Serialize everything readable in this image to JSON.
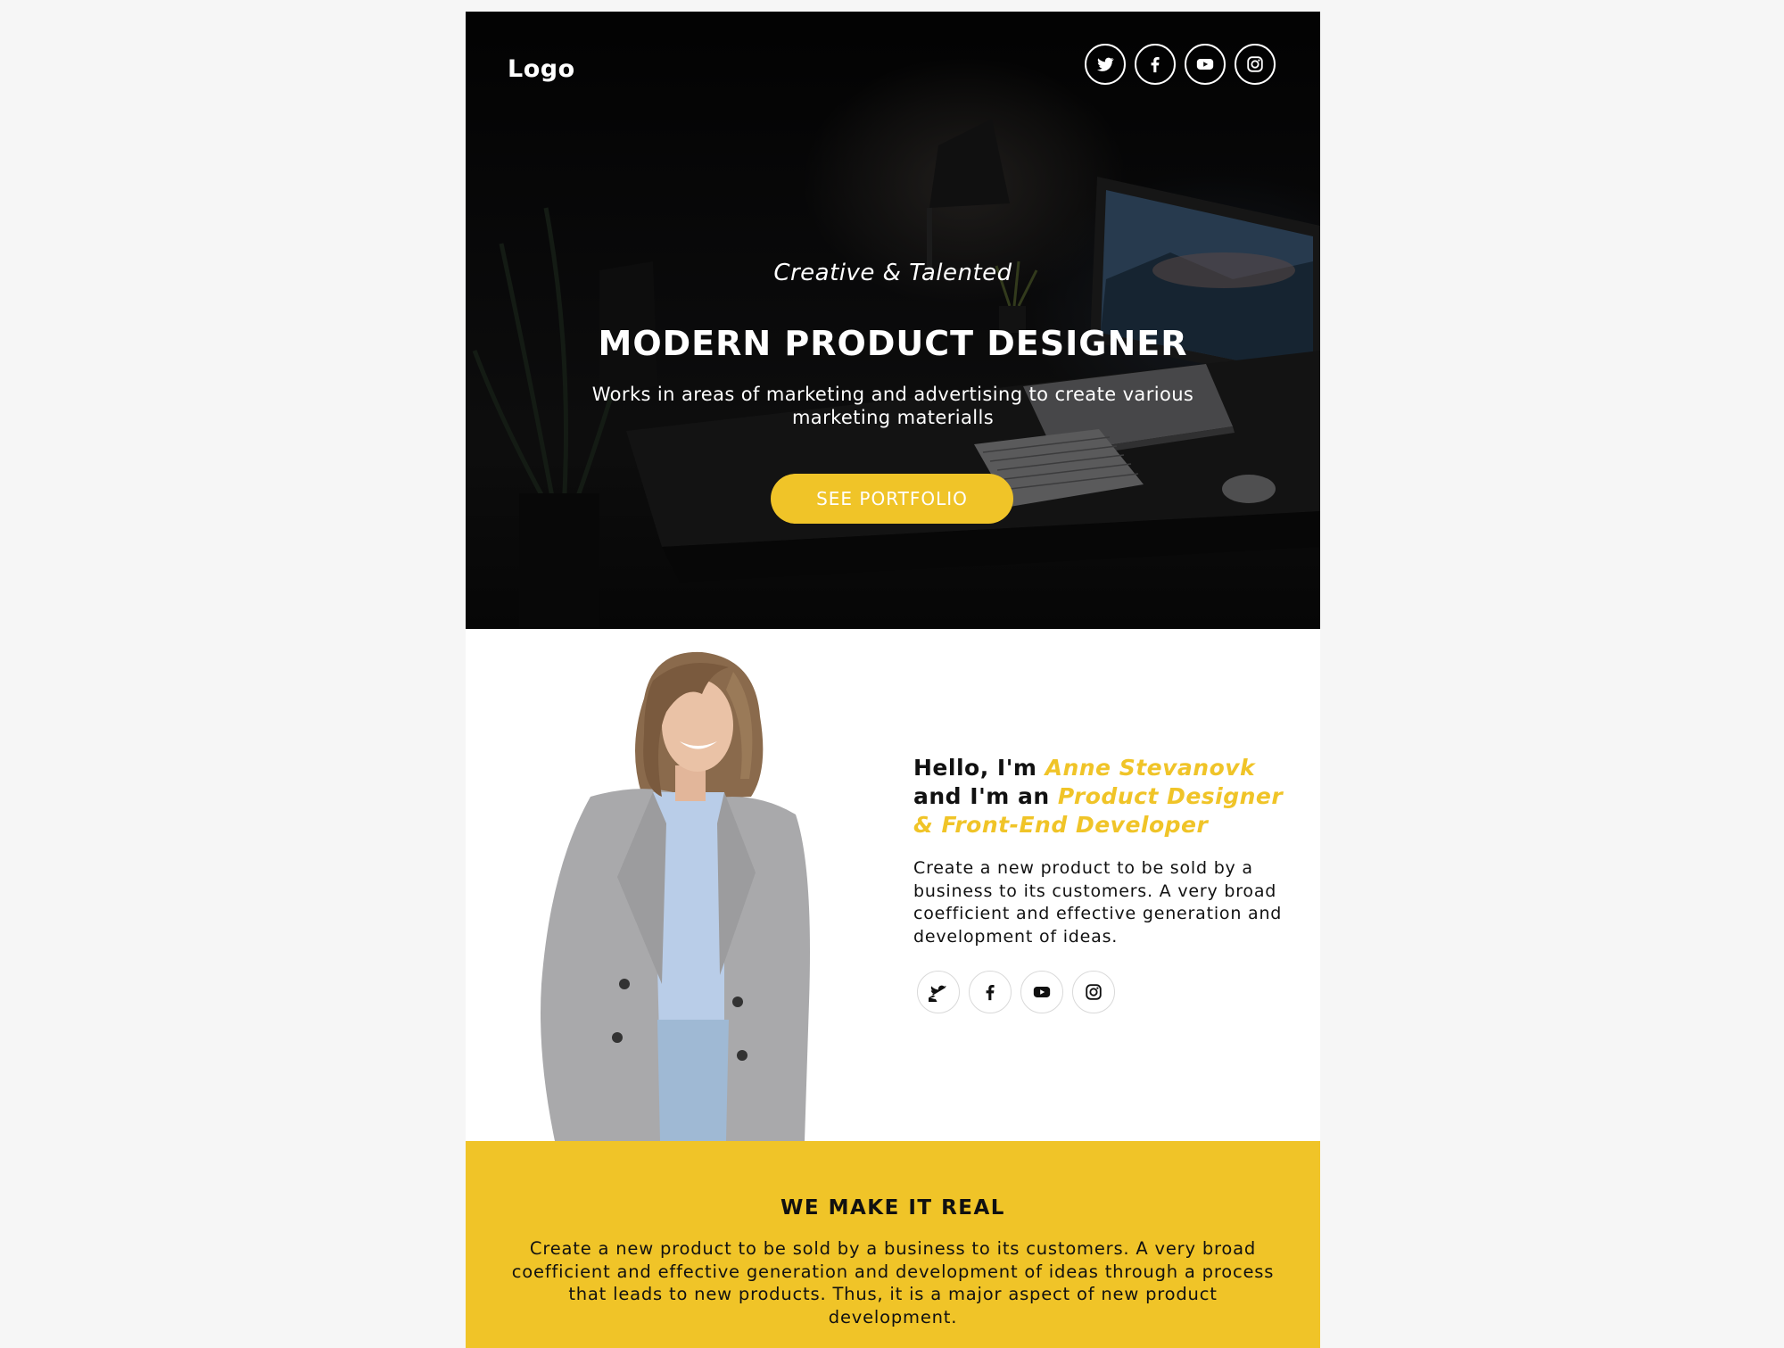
{
  "hero": {
    "logo": "Logo",
    "tagline": "Creative & Talented",
    "headline": "MODERN PRODUCT DESIGNER",
    "subhead": "Works in areas of marketing and advertising to create various marketing materialls",
    "cta_label": "SEE PORTFOLIO",
    "social_icons": [
      "twitter-icon",
      "facebook-icon",
      "youtube-icon",
      "instagram-icon"
    ]
  },
  "about": {
    "greeting_prefix": "Hello, I'm ",
    "name": "Anne Stevanovk",
    "greeting_middle": " and I'm an ",
    "role": "Product Designer & Front-End Developer",
    "body": "Create a new product to be sold by a business to its customers. A very broad coefficient and effective generation and development of ideas.",
    "social_icons": [
      "twitter-icon",
      "facebook-icon",
      "youtube-icon",
      "instagram-icon"
    ]
  },
  "band": {
    "title": "WE MAKE IT REAL",
    "body": "Create a new product to be sold by a business to its customers. A very broad coefficient and effective generation and development of ideas through a process that leads to new products. Thus, it is a major aspect of new product development."
  },
  "colors": {
    "accent": "#f0c428",
    "text": "#111111",
    "page_bg": "#f6f6f6"
  }
}
